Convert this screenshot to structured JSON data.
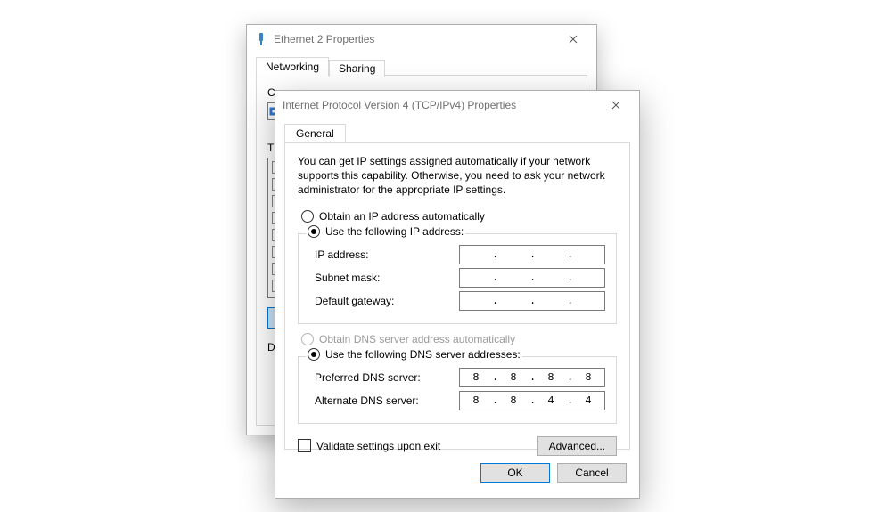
{
  "parent": {
    "title": "Ethernet 2 Properties",
    "tabs": {
      "networking": "Networking",
      "sharing": "Sharing"
    },
    "connect_label_cut": "Co",
    "this_label_cut": "Th",
    "desc_label_cut": "D"
  },
  "front": {
    "title": "Internet Protocol Version 4 (TCP/IPv4) Properties",
    "tab_general": "General",
    "description": "You can get IP settings assigned automatically if your network supports this capability. Otherwise, you need to ask your network administrator for the appropriate IP settings.",
    "ip_section": {
      "auto_label": "Obtain an IP address automatically",
      "manual_label": "Use the following IP address:",
      "selected": "manual",
      "fields": {
        "ip_label": "IP address:",
        "ip_value": [
          "",
          "",
          "",
          ""
        ],
        "mask_label": "Subnet mask:",
        "mask_value": [
          "",
          "",
          "",
          ""
        ],
        "gw_label": "Default gateway:",
        "gw_value": [
          "",
          "",
          "",
          ""
        ]
      }
    },
    "dns_section": {
      "auto_label": "Obtain DNS server address automatically",
      "auto_disabled": true,
      "manual_label": "Use the following DNS server addresses:",
      "selected": "manual",
      "fields": {
        "pref_label": "Preferred DNS server:",
        "pref_value": [
          "8",
          "8",
          "8",
          "8"
        ],
        "alt_label": "Alternate DNS server:",
        "alt_value": [
          "8",
          "8",
          "4",
          "4"
        ]
      }
    },
    "validate_label": "Validate settings upon exit",
    "validate_checked": false,
    "advanced_label": "Advanced...",
    "ok_label": "OK",
    "cancel_label": "Cancel"
  }
}
